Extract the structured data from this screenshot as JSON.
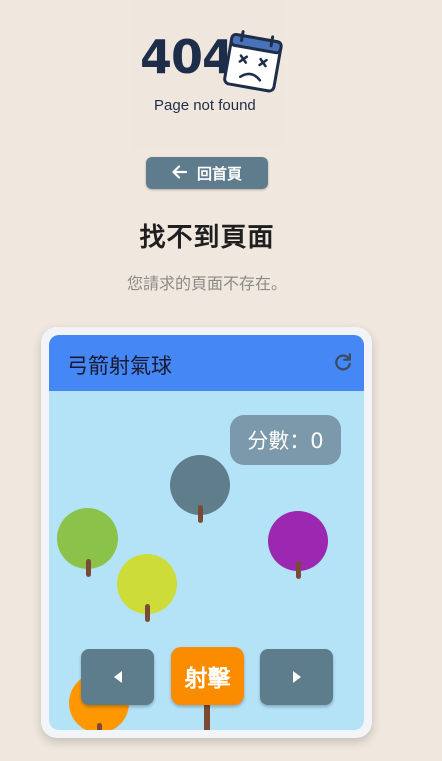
{
  "error_image": {
    "code_text": "404",
    "caption": "Page not found",
    "icon": "sad-calendar-icon"
  },
  "home_button": {
    "icon": "arrow-left-icon",
    "label": "回首頁"
  },
  "page_title": "找不到頁面",
  "page_subtitle": "您請求的頁面不存在。",
  "game": {
    "title": "弓箭射氣球",
    "refresh_icon": "refresh-icon",
    "score_text": "分數：0",
    "balloons": [
      {
        "color": "#607d8b"
      },
      {
        "color": "#8bc34a"
      },
      {
        "color": "#cddc39"
      },
      {
        "color": "#9c27b0"
      },
      {
        "color": "#ff9800"
      }
    ],
    "controls": {
      "left_icon": "triangle-left-icon",
      "shoot_label": "射擊",
      "right_icon": "triangle-right-icon"
    }
  }
}
